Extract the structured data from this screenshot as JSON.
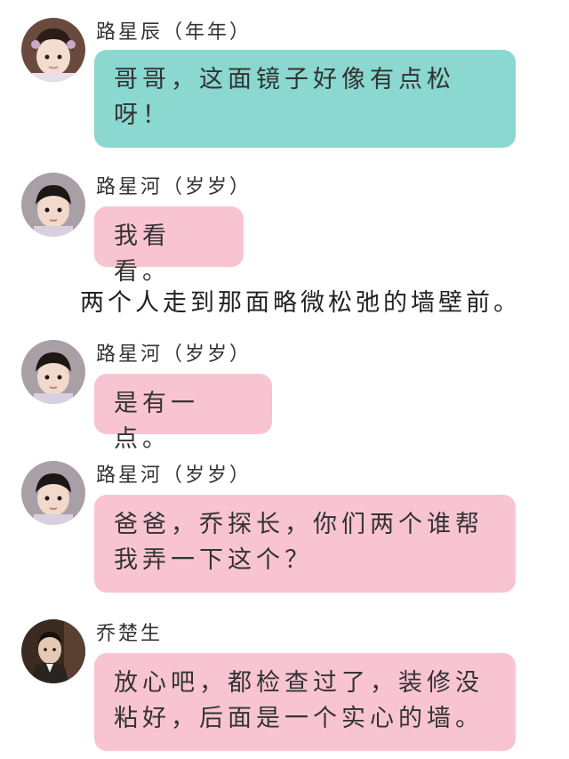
{
  "messages": [
    {
      "sender": "路星辰（年年）",
      "text": "哥哥，这面镜子好像有点松呀！",
      "bubble_color": "#8ad8cf",
      "avatar": "girl-avatar"
    },
    {
      "sender": "路星河（岁岁）",
      "text": "我看看。",
      "bubble_color": "#f9c4d2",
      "avatar": "boy-avatar"
    },
    {
      "sender": "路星河（岁岁）",
      "text": "是有一点。",
      "bubble_color": "#f9c4d2",
      "avatar": "boy-avatar"
    },
    {
      "sender": "路星河（岁岁）",
      "text": "爸爸，乔探长，你们两个谁帮我弄一下这个？",
      "bubble_color": "#f9c4d2",
      "avatar": "boy-avatar"
    },
    {
      "sender": "乔楚生",
      "text": "放心吧，都检查过了，装修没粘好，后面是一个实心的墙。",
      "bubble_color": "#f9c4d2",
      "avatar": "man-avatar"
    }
  ],
  "narration": "两个人走到那面略微松弛的墙壁前。"
}
